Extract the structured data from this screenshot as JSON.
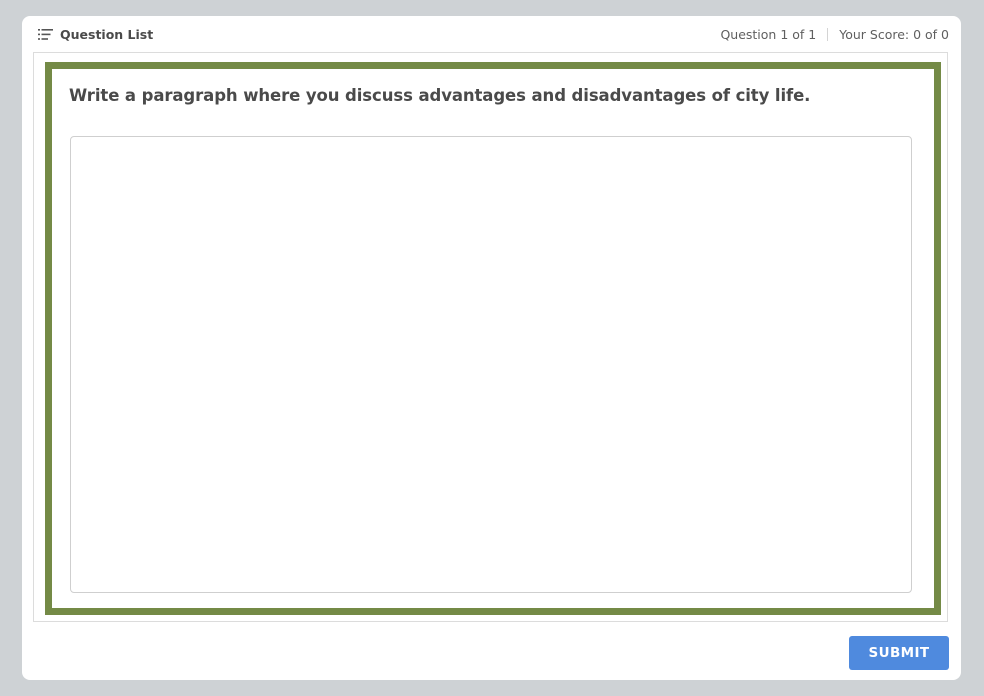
{
  "header": {
    "question_list_label": "Question List",
    "question_counter": "Question 1 of 1",
    "score": "Your Score: 0 of 0"
  },
  "question": {
    "prompt": "Write a paragraph where you discuss advantages and disadvantages of city life.",
    "answer_value": "",
    "answer_placeholder": ""
  },
  "actions": {
    "submit_label": "SUBMIT"
  },
  "icons": {
    "question_list": "list-icon"
  },
  "colors": {
    "page_background": "#ced2d5",
    "question_frame": "#748a46",
    "submit_button": "#4f8ade"
  }
}
